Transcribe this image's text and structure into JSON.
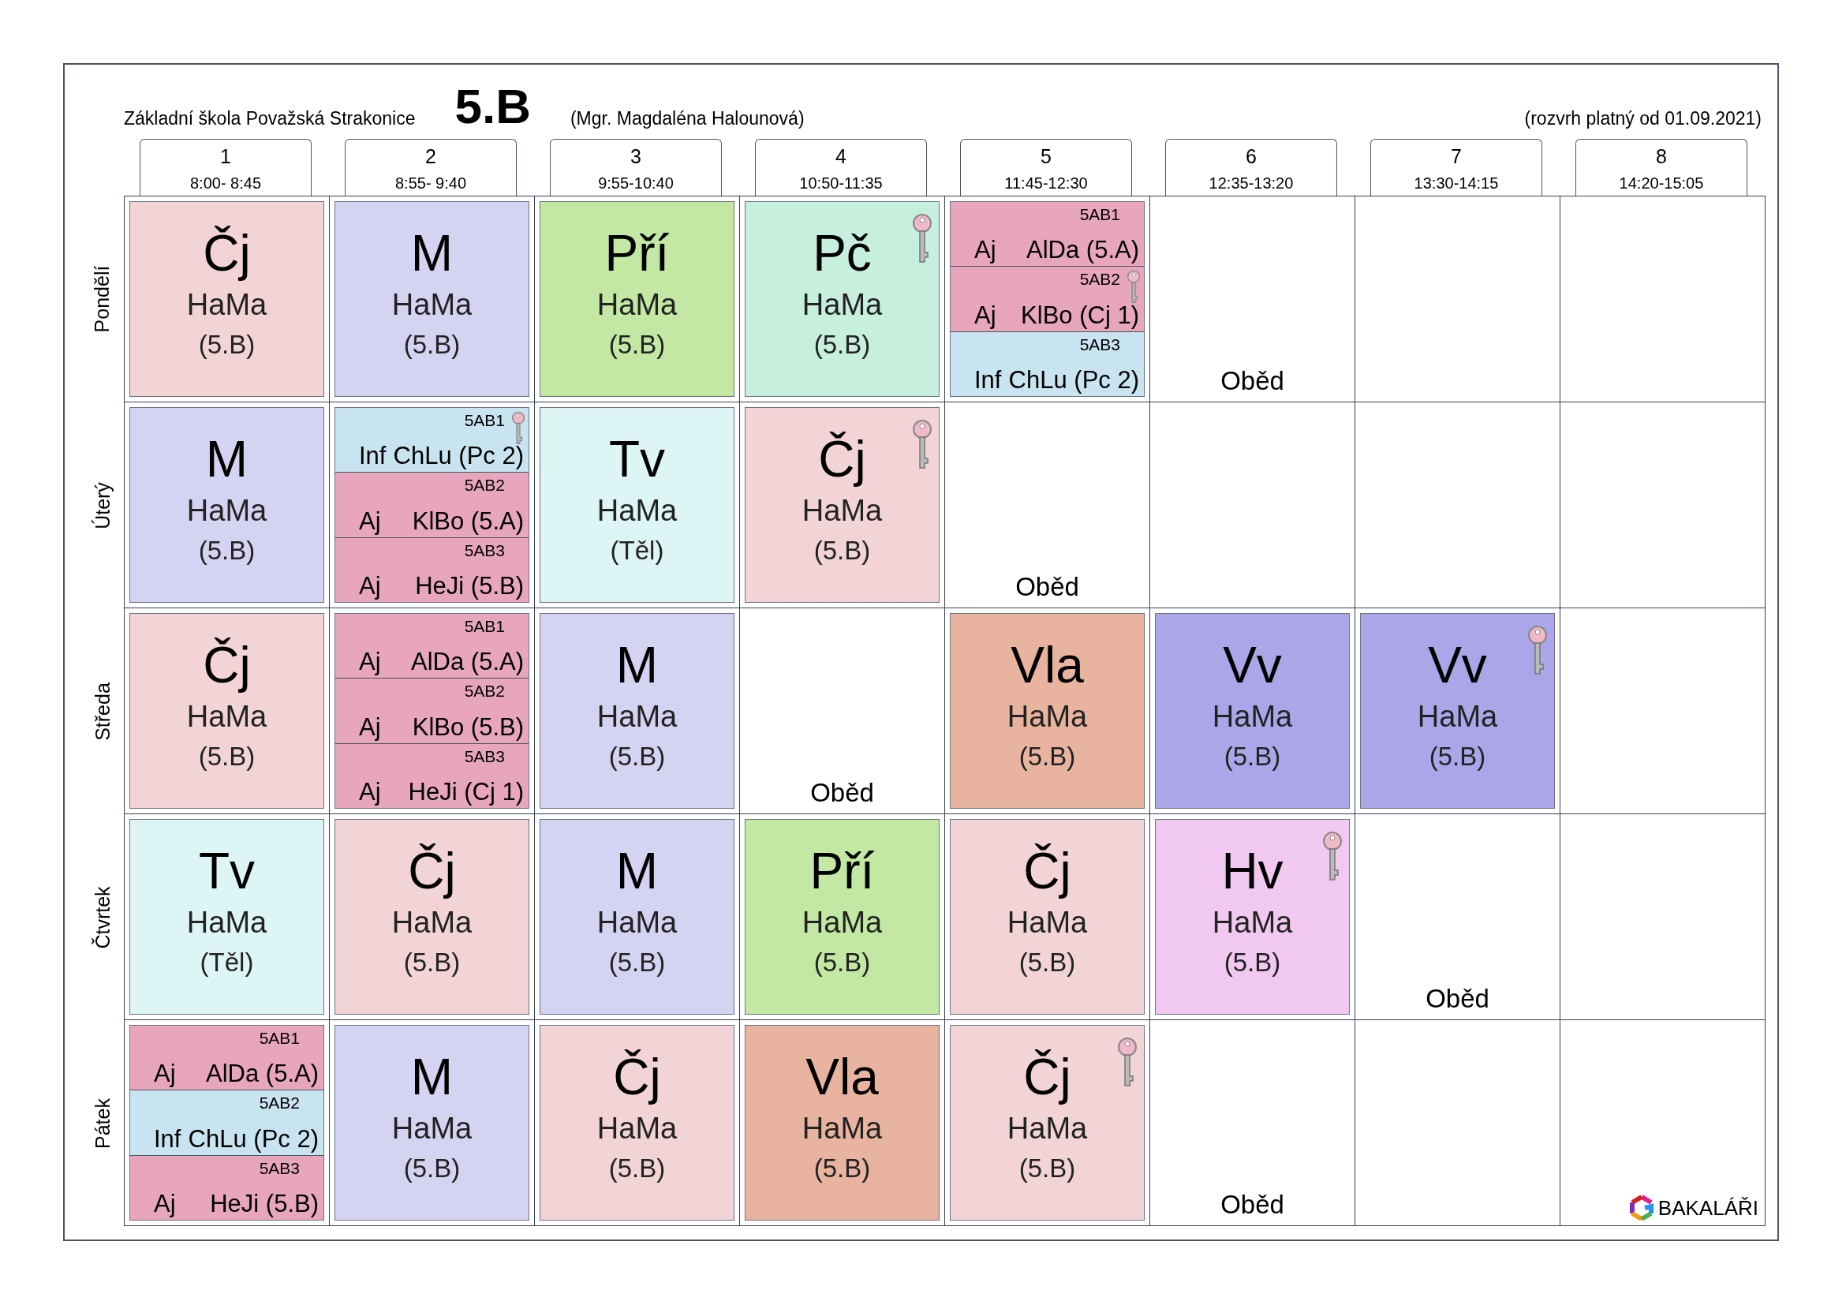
{
  "header": {
    "school": "Základní škola Považská Strakonice",
    "class_name": "5.B",
    "teacher": "(Mgr. Magdaléna Halounová)",
    "valid_from": "(rozvrh platný od 01.09.2021)"
  },
  "periods": [
    {
      "number": "1",
      "time": "8:00- 8:45"
    },
    {
      "number": "2",
      "time": "8:55- 9:40"
    },
    {
      "number": "3",
      "time": "9:55-10:40"
    },
    {
      "number": "4",
      "time": "10:50-11:35"
    },
    {
      "number": "5",
      "time": "11:45-12:30"
    },
    {
      "number": "6",
      "time": "12:35-13:20"
    },
    {
      "number": "7",
      "time": "13:30-14:15"
    },
    {
      "number": "8",
      "time": "14:20-15:05"
    }
  ],
  "days": [
    {
      "name": "Pondělí",
      "cells": [
        {
          "kind": "lesson",
          "subject": "Čj",
          "teacher": "HaMa",
          "room": "(5.B)",
          "color": "#f2d4d6",
          "key": false
        },
        {
          "kind": "lesson",
          "subject": "M",
          "teacher": "HaMa",
          "room": "(5.B)",
          "color": "#d5d3f2",
          "key": false
        },
        {
          "kind": "lesson",
          "subject": "Pří",
          "teacher": "HaMa",
          "room": "(5.B)",
          "color": "#c3e8a3",
          "key": false
        },
        {
          "kind": "lesson",
          "subject": "Pč",
          "teacher": "HaMa",
          "room": "(5.B)",
          "color": "#c6efdd",
          "key": true
        },
        {
          "kind": "split",
          "groups": [
            {
              "group": "5AB1",
              "subject": "Aj",
              "teacher": "AlDa",
              "room": "(5.A)",
              "color": "#e8a6bd",
              "key": false
            },
            {
              "group": "5AB2",
              "subject": "Aj",
              "teacher": "KlBo",
              "room": "(Cj 1)",
              "color": "#e8a6bd",
              "key": true
            },
            {
              "group": "5AB3",
              "subject": "Inf",
              "teacher": "ChLu",
              "room": "(Pc 2)",
              "color": "#c8e4f0",
              "key": false
            }
          ]
        },
        {
          "kind": "lunch",
          "label": "Oběd"
        },
        {
          "kind": "empty"
        },
        {
          "kind": "empty"
        }
      ]
    },
    {
      "name": "Úterý",
      "cells": [
        {
          "kind": "lesson",
          "subject": "M",
          "teacher": "HaMa",
          "room": "(5.B)",
          "color": "#d5d3f2",
          "key": false
        },
        {
          "kind": "split",
          "groups": [
            {
              "group": "5AB1",
              "subject": "Inf",
              "teacher": "ChLu",
              "room": "(Pc 2)",
              "color": "#c8e4f0",
              "key": true
            },
            {
              "group": "5AB2",
              "subject": "Aj",
              "teacher": "KlBo",
              "room": "(5.A)",
              "color": "#e8a6bd",
              "key": false
            },
            {
              "group": "5AB3",
              "subject": "Aj",
              "teacher": "HeJi",
              "room": "(5.B)",
              "color": "#e8a6bd",
              "key": false
            }
          ]
        },
        {
          "kind": "lesson",
          "subject": "Tv",
          "teacher": "HaMa",
          "room": "(Těl)",
          "color": "#def5f5",
          "key": false
        },
        {
          "kind": "lesson",
          "subject": "Čj",
          "teacher": "HaMa",
          "room": "(5.B)",
          "color": "#f2d4d6",
          "key": true
        },
        {
          "kind": "lunch",
          "label": "Oběd"
        },
        {
          "kind": "empty"
        },
        {
          "kind": "empty"
        },
        {
          "kind": "empty"
        }
      ]
    },
    {
      "name": "Středa",
      "cells": [
        {
          "kind": "lesson",
          "subject": "Čj",
          "teacher": "HaMa",
          "room": "(5.B)",
          "color": "#f2d4d6",
          "key": false
        },
        {
          "kind": "split",
          "groups": [
            {
              "group": "5AB1",
              "subject": "Aj",
              "teacher": "AlDa",
              "room": "(5.A)",
              "color": "#e8a6bd",
              "key": false
            },
            {
              "group": "5AB2",
              "subject": "Aj",
              "teacher": "KlBo",
              "room": "(5.B)",
              "color": "#e8a6bd",
              "key": false
            },
            {
              "group": "5AB3",
              "subject": "Aj",
              "teacher": "HeJi",
              "room": "(Cj 1)",
              "color": "#e8a6bd",
              "key": false
            }
          ]
        },
        {
          "kind": "lesson",
          "subject": "M",
          "teacher": "HaMa",
          "room": "(5.B)",
          "color": "#d5d3f2",
          "key": false
        },
        {
          "kind": "lunch",
          "label": "Oběd"
        },
        {
          "kind": "lesson",
          "subject": "Vla",
          "teacher": "HaMa",
          "room": "(5.B)",
          "color": "#e8b4a0",
          "key": false
        },
        {
          "kind": "lesson",
          "subject": "Vv",
          "teacher": "HaMa",
          "room": "(5.B)",
          "color": "#aaa6e8",
          "key": false
        },
        {
          "kind": "lesson",
          "subject": "Vv",
          "teacher": "HaMa",
          "room": "(5.B)",
          "color": "#aaa6e8",
          "key": true
        },
        {
          "kind": "empty"
        }
      ]
    },
    {
      "name": "Čtvrtek",
      "cells": [
        {
          "kind": "lesson",
          "subject": "Tv",
          "teacher": "HaMa",
          "room": "(Těl)",
          "color": "#def5f5",
          "key": false
        },
        {
          "kind": "lesson",
          "subject": "Čj",
          "teacher": "HaMa",
          "room": "(5.B)",
          "color": "#f2d4d6",
          "key": false
        },
        {
          "kind": "lesson",
          "subject": "M",
          "teacher": "HaMa",
          "room": "(5.B)",
          "color": "#d5d3f2",
          "key": false
        },
        {
          "kind": "lesson",
          "subject": "Pří",
          "teacher": "HaMa",
          "room": "(5.B)",
          "color": "#c3e8a3",
          "key": false
        },
        {
          "kind": "lesson",
          "subject": "Čj",
          "teacher": "HaMa",
          "room": "(5.B)",
          "color": "#f2d4d6",
          "key": false
        },
        {
          "kind": "lesson",
          "subject": "Hv",
          "teacher": "HaMa",
          "room": "(5.B)",
          "color": "#f0c8f0",
          "key": true
        },
        {
          "kind": "lunch",
          "label": "Oběd"
        },
        {
          "kind": "empty"
        }
      ]
    },
    {
      "name": "Pátek",
      "cells": [
        {
          "kind": "split",
          "groups": [
            {
              "group": "5AB1",
              "subject": "Aj",
              "teacher": "AlDa",
              "room": "(5.A)",
              "color": "#e8a6bd",
              "key": false
            },
            {
              "group": "5AB2",
              "subject": "Inf",
              "teacher": "ChLu",
              "room": "(Pc 2)",
              "color": "#c8e4f0",
              "key": false
            },
            {
              "group": "5AB3",
              "subject": "Aj",
              "teacher": "HeJi",
              "room": "(5.B)",
              "color": "#e8a6bd",
              "key": false
            }
          ]
        },
        {
          "kind": "lesson",
          "subject": "M",
          "teacher": "HaMa",
          "room": "(5.B)",
          "color": "#d5d3f2",
          "key": false
        },
        {
          "kind": "lesson",
          "subject": "Čj",
          "teacher": "HaMa",
          "room": "(5.B)",
          "color": "#f2d4d6",
          "key": false
        },
        {
          "kind": "lesson",
          "subject": "Vla",
          "teacher": "HaMa",
          "room": "(5.B)",
          "color": "#e8b4a0",
          "key": false
        },
        {
          "kind": "lesson",
          "subject": "Čj",
          "teacher": "HaMa",
          "room": "(5.B)",
          "color": "#f2d4d6",
          "key": true
        },
        {
          "kind": "lunch",
          "label": "Oběd"
        },
        {
          "kind": "empty"
        },
        {
          "kind": "empty"
        }
      ]
    }
  ],
  "logo": {
    "text": "BAKALÁŘI"
  }
}
